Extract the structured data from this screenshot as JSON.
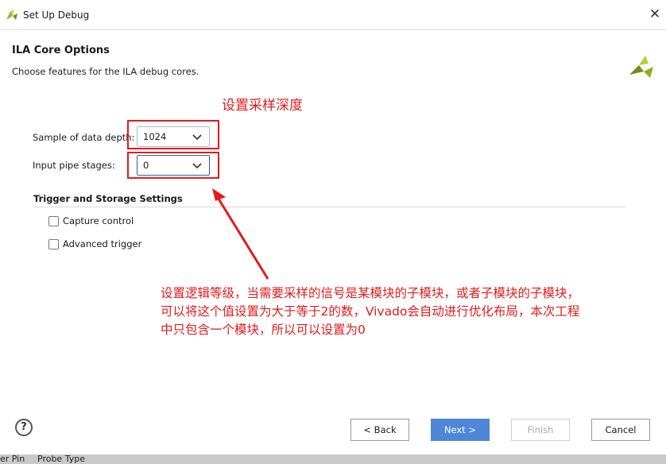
{
  "window": {
    "title": "Set Up Debug"
  },
  "header": {
    "title": "ILA Core Options",
    "subtitle": "Choose features for the ILA debug cores."
  },
  "fields": {
    "sample_depth": {
      "label": "Sample of data depth:",
      "value": "1024"
    },
    "pipe_stages": {
      "label": "Input pipe stages:",
      "value": "0"
    }
  },
  "section": {
    "title": "Trigger and Storage Settings",
    "capture_control": {
      "label": "Capture control",
      "checked": false
    },
    "advanced_trigger": {
      "label": "Advanced trigger",
      "checked": false
    }
  },
  "annotations": {
    "depth_note": "设置采样深度",
    "stage_note": [
      "设置逻辑等级，当需要采样的信号是某模块的子模块，或者子模块的子模块，",
      "可以将这个值设置为大于等于2的数，Vivado会自动进行优化布局，本次工程",
      "中只包含一个模块，所以可以设置为0"
    ],
    "color": "#e21b1b"
  },
  "buttons": {
    "help": "?",
    "back": "< Back",
    "next": "Next >",
    "finish": "Finish",
    "cancel": "Cancel"
  },
  "background": {
    "col1": "er Pin",
    "col2": "Probe Type"
  },
  "colors": {
    "accent": "#4f86d8",
    "focus": "#2f63b7",
    "logo": "#9bbb24"
  }
}
